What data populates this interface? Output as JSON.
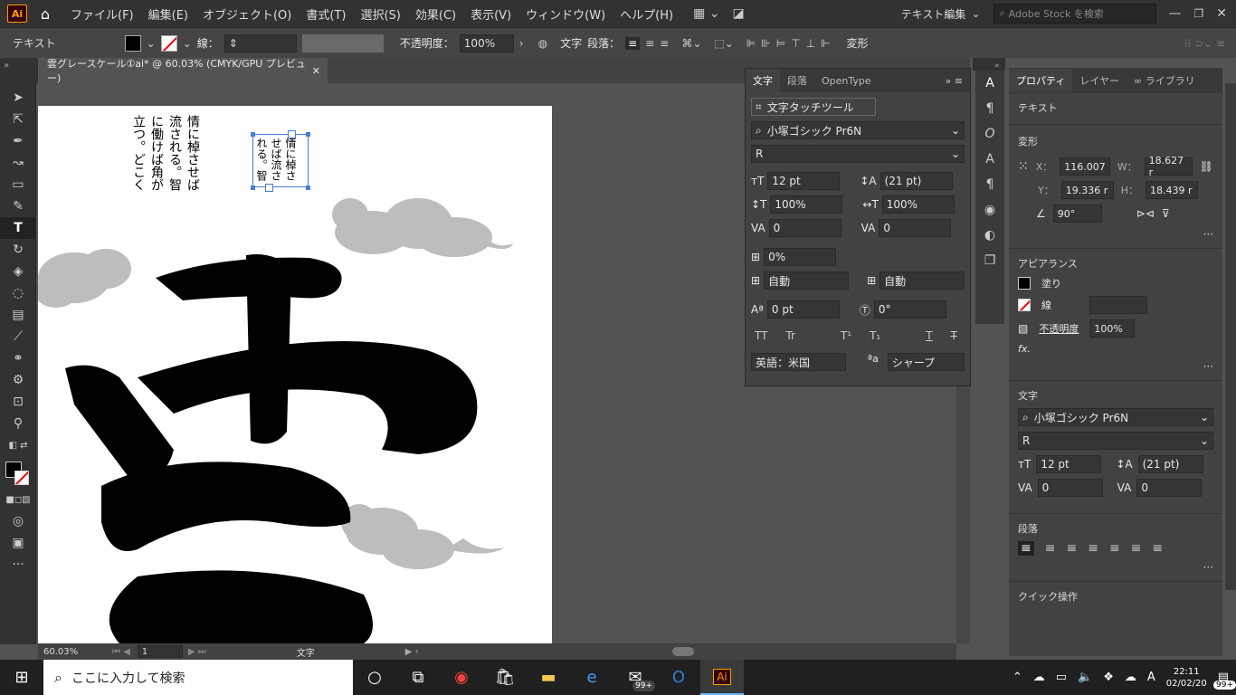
{
  "menubar": {
    "app_logo": "Ai",
    "items": [
      "ファイル(F)",
      "編集(E)",
      "オブジェクト(O)",
      "書式(T)",
      "選択(S)",
      "効果(C)",
      "表示(V)",
      "ウィンドウ(W)",
      "ヘルプ(H)"
    ],
    "workspace": "テキスト編集",
    "stock_search_placeholder": "Adobe Stock を検索"
  },
  "controlbar": {
    "mode_label": "テキスト",
    "stroke_label": "線：",
    "opacity_label": "不透明度：",
    "opacity_value": "100%",
    "char_label": "文字",
    "para_label": "段落：",
    "transform_label": "変形"
  },
  "document": {
    "tab_title": "雲グレースケール①ai* @ 60.03% (CMYK/GPU プレビュー)",
    "vertical_text_1": [
      "情に棹させば",
      "流される。智",
      "に働けば角が",
      "立つ。どこく"
    ],
    "vertical_text_2": [
      "情に棹さ",
      "せば流さ",
      "れる。智"
    ],
    "kanji": "雲"
  },
  "statusbar": {
    "zoom": "60.03%",
    "page": "1",
    "tool": "文字"
  },
  "char_panel": {
    "tabs": [
      "文字",
      "段落",
      "OpenType"
    ],
    "touch_tool": "文字タッチツール",
    "font_family": "小塚ゴシック Pr6N",
    "font_style": "R",
    "font_size": "12 pt",
    "leading": "(21 pt)",
    "vert_scale": "100%",
    "horiz_scale": "100%",
    "kerning": "0",
    "tracking": "0",
    "tsume": "0%",
    "aki_left": "自動",
    "aki_right": "自動",
    "baseline": "0 pt",
    "rotation": "0°",
    "language": "英語：米国",
    "antialias": "シャープ"
  },
  "prop_panel": {
    "tabs": [
      "プロパティ",
      "レイヤー",
      "ライブラリ"
    ],
    "section_text": "テキスト",
    "section_transform": "変形",
    "x_label": "X：",
    "x": "116.007",
    "y_label": "Y：",
    "y": "19.336 r",
    "w_label": "W：",
    "w": "18.627 r",
    "h_label": "H：",
    "h": "18.439 r",
    "angle": "90°",
    "section_appearance": "アピアランス",
    "fill_label": "塗り",
    "stroke_label": "線",
    "opacity_label": "不透明度",
    "opacity": "100%",
    "fx": "fx.",
    "section_char": "文字",
    "font_family": "小塚ゴシック Pr6N",
    "font_style": "R",
    "font_size": "12 pt",
    "leading": "(21 pt)",
    "kerning": "0",
    "tracking": "0",
    "section_para": "段落",
    "section_quick": "クイック操作"
  },
  "taskbar": {
    "search_placeholder": "ここに入力して検索",
    "badge1": "99+",
    "badge2": "99+",
    "ime": "A",
    "time": "22:11",
    "date": "02/02/20"
  }
}
